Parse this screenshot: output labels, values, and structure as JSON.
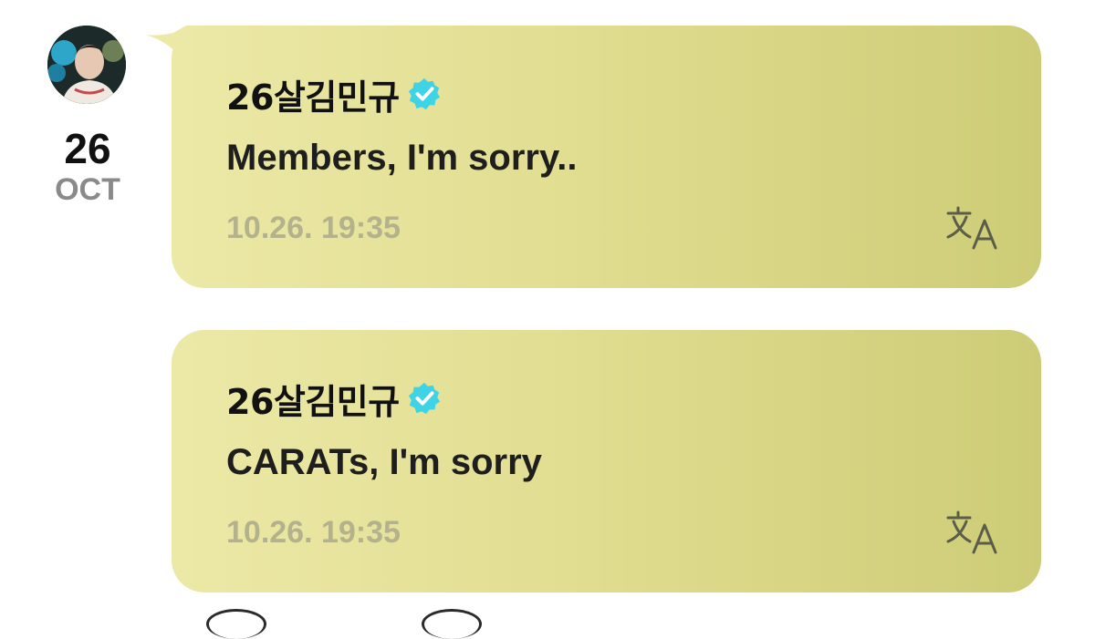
{
  "post_date": {
    "day": "26",
    "month": "OCT"
  },
  "messages": [
    {
      "author": "26살김민규",
      "verified_icon": "verified-badge-icon",
      "text": "Members, I'm sorry..",
      "time": "10.26. 19:35",
      "translate_icon": "translate-icon"
    },
    {
      "author": "26살김민규",
      "verified_icon": "verified-badge-icon",
      "text": "CARATs, I'm sorry",
      "time": "10.26. 19:35",
      "translate_icon": "translate-icon"
    }
  ],
  "colors": {
    "bubble_start": "#ece9a7",
    "bubble_end": "#cdcc76",
    "verified_badge": "#3fd3e6",
    "timestamp": "#b3b28c",
    "month_text": "#8a8a8a"
  }
}
